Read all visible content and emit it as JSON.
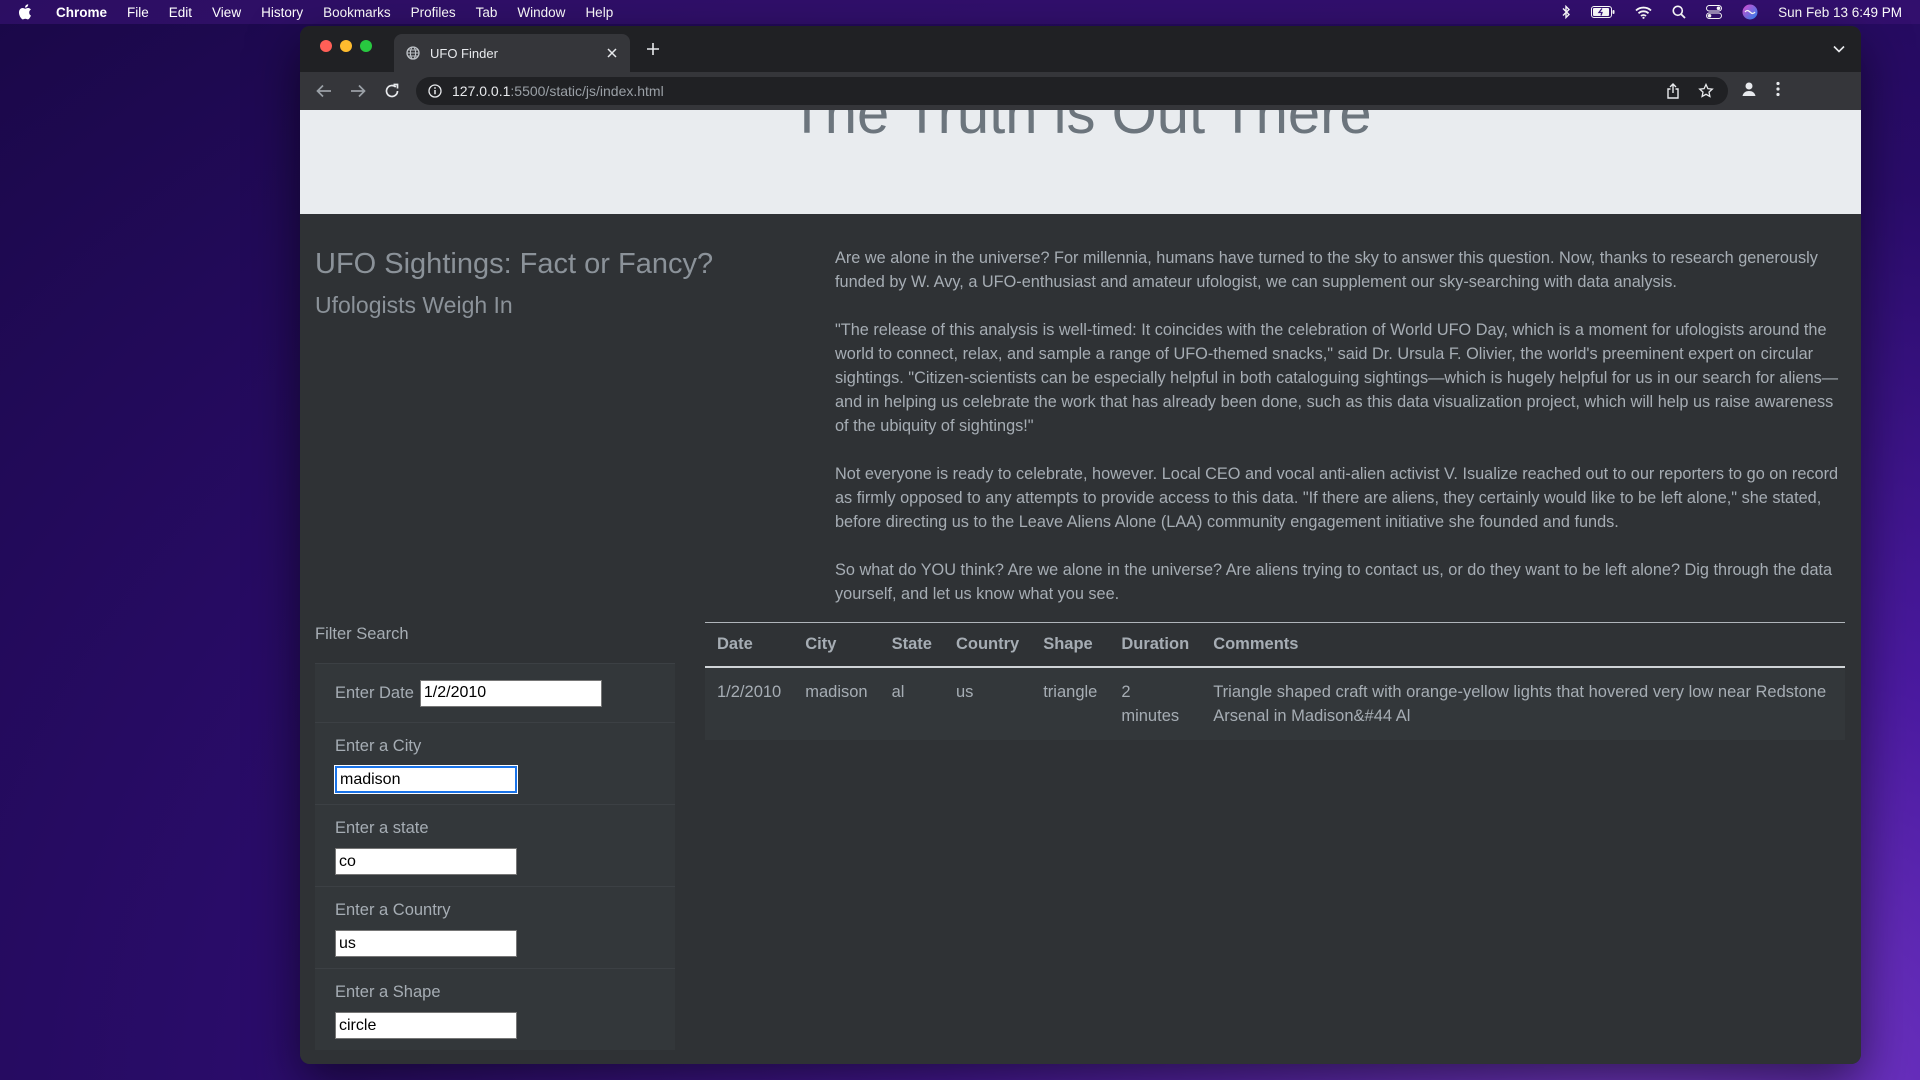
{
  "menubar": {
    "app": "Chrome",
    "items": [
      "File",
      "Edit",
      "View",
      "History",
      "Bookmarks",
      "Profiles",
      "Tab",
      "Window",
      "Help"
    ],
    "clock": "Sun Feb 13  6:49 PM"
  },
  "browser": {
    "tab_title": "UFO Finder",
    "url_host": "127.0.0.1",
    "url_path": ":5500/static/js/index.html"
  },
  "page": {
    "jumbotron_title": "The Truth is Out There",
    "headline_main": "UFO Sightings: Fact or Fancy?",
    "headline_sub": "Ufologists Weigh In",
    "paragraphs": [
      "Are we alone in the universe? For millennia, humans have turned to the sky to answer this question. Now, thanks to research generously funded by W. Avy, a UFO-enthusiast and amateur ufologist, we can supplement our sky-searching with data analysis.",
      "\"The release of this analysis is well-timed: It coincides with the celebration of World UFO Day, which is a moment for ufologists around the world to connect, relax, and sample a range of UFO-themed snacks,\" said Dr. Ursula F. Olivier, the world's preeminent expert on circular sightings. \"Citizen-scientists can be especially helpful in both cataloguing sightings—which is hugely helpful for us in our search for aliens—and in helping us celebrate the work that has already been done, such as this data visualization project, which will help us raise awareness of the ubiquity of sightings!\"",
      "Not everyone is ready to celebrate, however. Local CEO and vocal anti-alien activist V. Isualize reached out to our reporters to go on record as firmly opposed to any attempts to provide access to this data. \"If there are aliens, they certainly would like to be left alone,\" she stated, before directing us to the Leave Aliens Alone (LAA) community engagement initiative she founded and funds.",
      "So what do YOU think? Are we alone in the universe? Are aliens trying to contact us, or do they want to be left alone? Dig through the data yourself, and let us know what you see."
    ],
    "filter": {
      "title": "Filter Search",
      "date_label": "Enter Date",
      "date_value": "1/2/2010",
      "city_label": "Enter a City",
      "city_value": "madison",
      "state_label": "Enter a state",
      "state_value": "co",
      "country_label": "Enter a Country",
      "country_value": "us",
      "shape_label": "Enter a Shape",
      "shape_value": "circle"
    },
    "table": {
      "headers": [
        "Date",
        "City",
        "State",
        "Country",
        "Shape",
        "Duration",
        "Comments"
      ],
      "rows": [
        [
          "1/2/2010",
          "madison",
          "al",
          "us",
          "triangle",
          "2 minutes",
          "Triangle shaped craft with orange-yellow lights that hovered very low near Redstone Arsenal in Madison&#44 Al"
        ]
      ]
    }
  }
}
